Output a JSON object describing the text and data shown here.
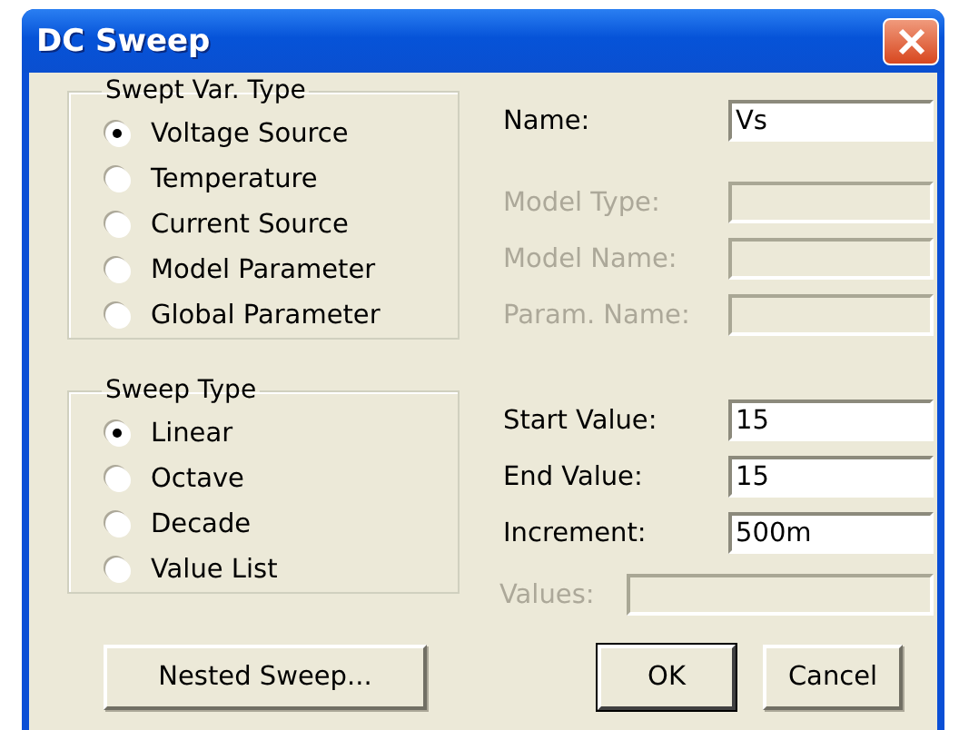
{
  "window": {
    "title": "DC Sweep"
  },
  "swept_var_type": {
    "title": "Swept Var. Type",
    "options": [
      {
        "label": "Voltage Source",
        "selected": true
      },
      {
        "label": "Temperature",
        "selected": false
      },
      {
        "label": "Current Source",
        "selected": false
      },
      {
        "label": "Model Parameter",
        "selected": false
      },
      {
        "label": "Global Parameter",
        "selected": false
      }
    ]
  },
  "source_fields": [
    {
      "label": "Name:",
      "value": "Vs",
      "disabled": false
    },
    {
      "label": "Model Type:",
      "disabled": true
    },
    {
      "label": "Model Name:",
      "disabled": true
    },
    {
      "label": "Param. Name:",
      "disabled": true
    }
  ],
  "sweep_type": {
    "title": "Sweep Type",
    "options": [
      {
        "label": "Linear",
        "selected": true
      },
      {
        "label": "Octave",
        "selected": false
      },
      {
        "label": "Decade",
        "selected": false
      },
      {
        "label": "Value List",
        "selected": false
      }
    ]
  },
  "sweep_fields": [
    {
      "label": "Start Value:",
      "value": "15",
      "disabled": false
    },
    {
      "label": "End Value:",
      "value": "15",
      "disabled": false
    },
    {
      "label": "Increment:",
      "value": "500m",
      "disabled": false
    }
  ],
  "values_field": {
    "label": "Values:",
    "disabled": true
  },
  "buttons": [
    {
      "label": "Nested Sweep...",
      "default": false
    },
    {
      "label": "OK",
      "default": true
    },
    {
      "label": "Cancel",
      "default": false
    }
  ]
}
